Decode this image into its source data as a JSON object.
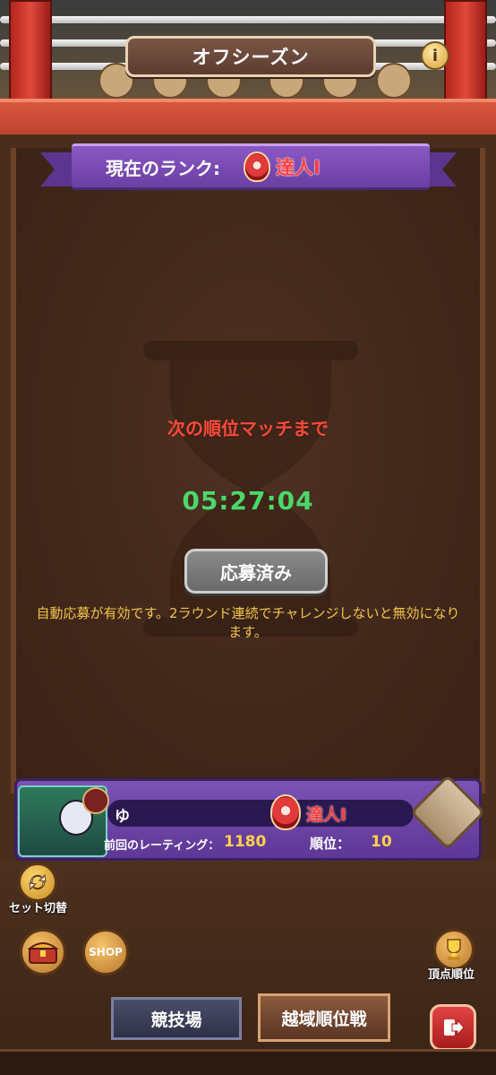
{
  "header": {
    "title": "オフシーズン",
    "info_icon": "info-icon"
  },
  "current_rank": {
    "label": "現在のランク:",
    "rank": "達人Ⅰ",
    "badge_icon": "rank-badge-icon"
  },
  "countdown": {
    "caption": "次の順位マッチまで",
    "time": "05:27:04"
  },
  "entry": {
    "button_label": "応募済み",
    "note": "自動応募が有効です。2ラウンド連続でチャレンジしないと無効になります。"
  },
  "player": {
    "name": "ゆ",
    "rank": "達人Ⅰ",
    "prev_rating_label": "前回のレーティング：",
    "prev_rating": "1180",
    "position_label": "順位：",
    "position": "10"
  },
  "side": {
    "set_switch_label": "セット切替",
    "shop_label": "SHOP",
    "top_rank_label": "頂点順位"
  },
  "tabs": [
    {
      "label": "競技場",
      "active": false
    },
    {
      "label": "越域順位戦",
      "active": true
    }
  ],
  "colors": {
    "ribbon": "#7b52b5",
    "timer": "#4bd86a",
    "caption": "#ff4a3a",
    "note": "#f2c64a"
  }
}
